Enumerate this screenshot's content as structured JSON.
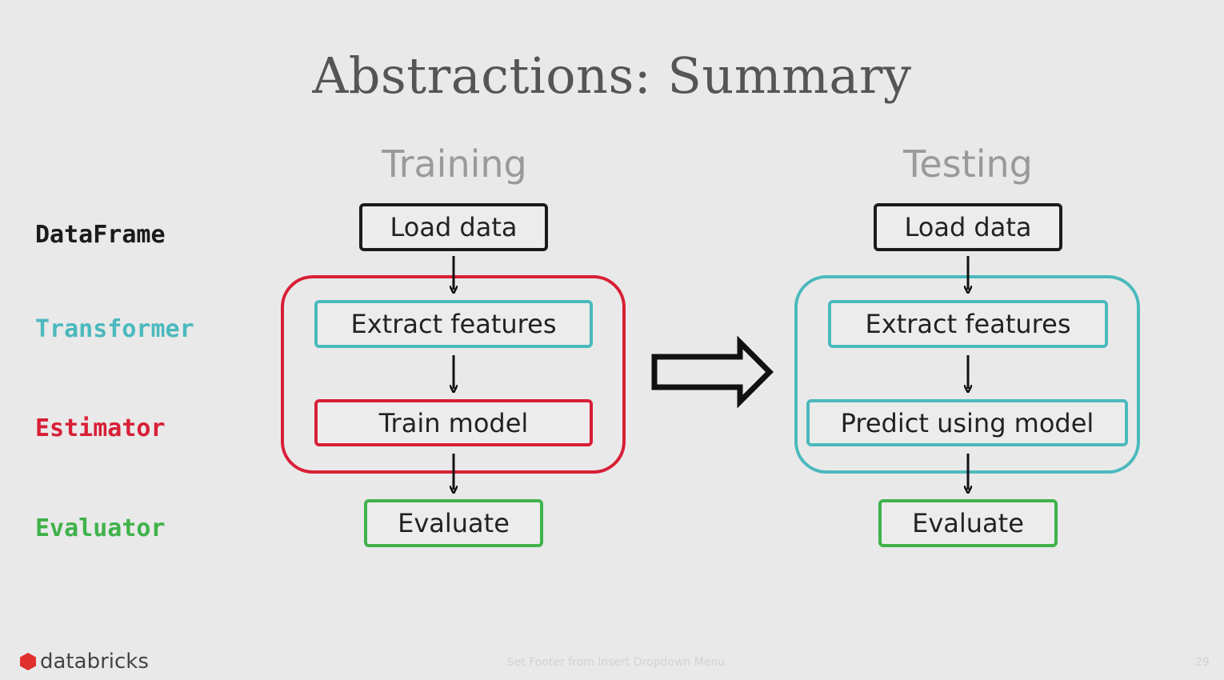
{
  "title": "Abstractions: Summary",
  "columns": {
    "training": "Training",
    "testing": "Testing"
  },
  "row_labels": {
    "dataframe": "DataFrame",
    "transformer": "Transformer",
    "estimator": "Estimator",
    "evaluator": "Evaluator"
  },
  "training": {
    "load": "Load data",
    "extract": "Extract features",
    "model": "Train model",
    "evaluate": "Evaluate"
  },
  "testing": {
    "load": "Load data",
    "extract": "Extract features",
    "model": "Predict using model",
    "evaluate": "Evaluate"
  },
  "footer": {
    "logo": "databricks",
    "text": "Set Footer from Insert Dropdown Menu",
    "page": "29"
  },
  "colors": {
    "dataframe": "#1b1b1b",
    "transformer": "#4bb9bd",
    "estimator": "#d81f36",
    "evaluator": "#3fb24a"
  }
}
